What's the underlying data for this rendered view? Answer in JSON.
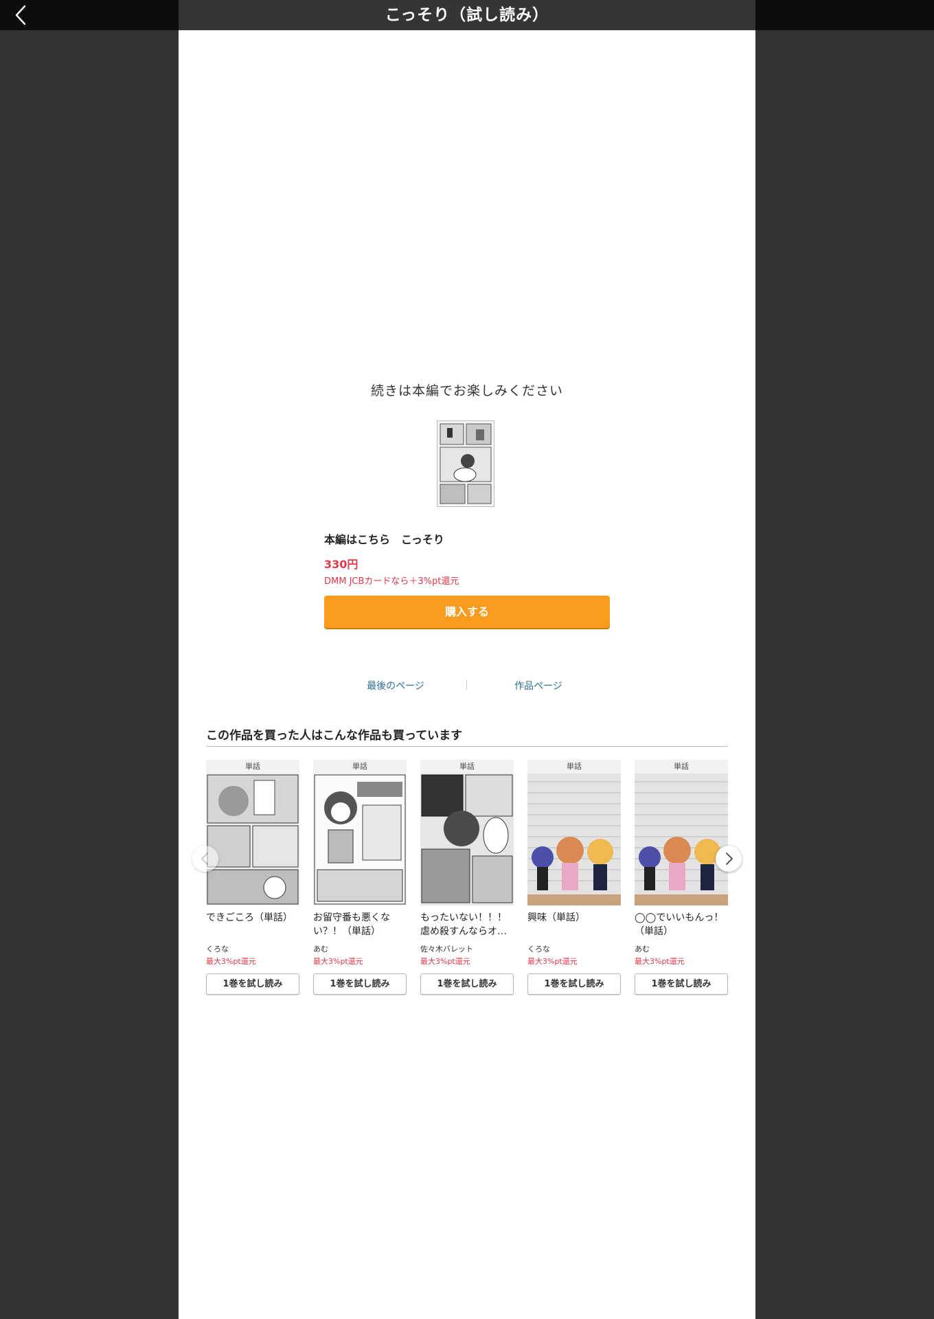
{
  "header": {
    "title": "こっそり（試し読み）",
    "back_icon": "chevron-left-icon"
  },
  "end_section": {
    "message": "続きは本編でお楽しみください",
    "main_title": "本編はこちら　こっそり",
    "price": "330円",
    "promo": "DMM JCBカードなら＋3%pt還元",
    "buy_label": "購入する",
    "buy_color": "#f99b1c",
    "last_page_label": "最後のページ",
    "work_page_label": "作品ページ"
  },
  "recommendations": {
    "title": "この作品を買った人はこんな作品も買っています",
    "items": [
      {
        "tag": "単話",
        "name": "できごころ（単話）",
        "author": "くろな",
        "points": "最大3%pt還元",
        "button": "1巻を試し読み"
      },
      {
        "tag": "単話",
        "name": "お留守番も悪くない？！（単話）",
        "author": "あむ",
        "points": "最大3%pt還元",
        "button": "1巻を試し読み"
      },
      {
        "tag": "単話",
        "name": "もったいない！！！虐め殺すんならオ…",
        "author": "佐々木バレット",
        "points": "最大3%pt還元",
        "button": "1巻を試し読み"
      },
      {
        "tag": "単話",
        "name": "興味（単話）",
        "author": "くろな",
        "points": "最大3%pt還元",
        "button": "1巻を試し読み"
      },
      {
        "tag": "単話",
        "name": "◯◯でいいもんっ！（単話）",
        "author": "あむ",
        "points": "最大3%pt還元",
        "button": "1巻を試し読み"
      }
    ]
  },
  "colors": {
    "accent_red": "#e0394b",
    "link_blue": "#2d6e9a",
    "bg_dark": "#333333"
  }
}
